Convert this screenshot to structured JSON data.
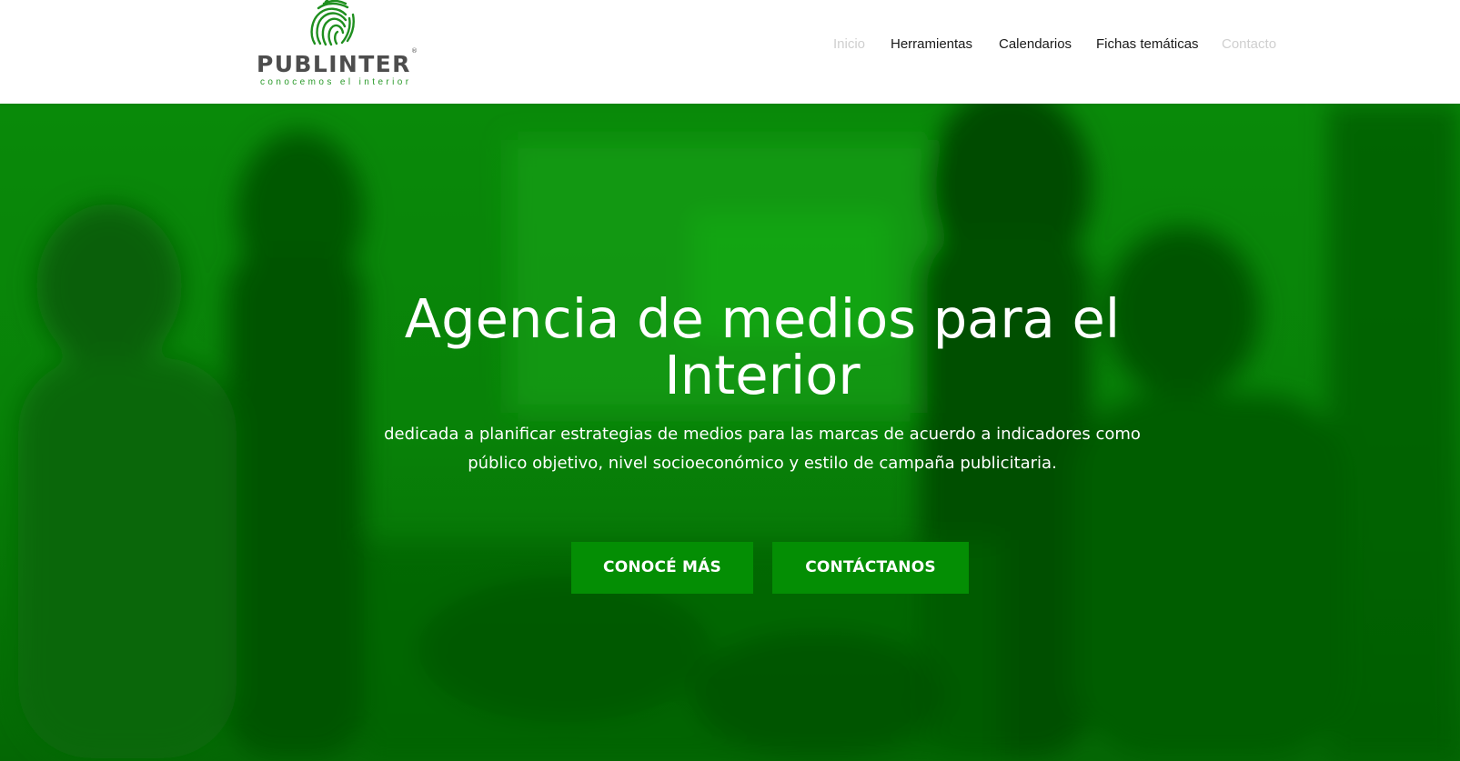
{
  "brand": {
    "name": "PUBLINTER",
    "registered": "®",
    "tagline": "conocemos el interior",
    "color_green": "#2a9a2a",
    "color_gray": "#4d4d4d"
  },
  "nav": {
    "items": [
      {
        "label": "Inicio",
        "state": "muted"
      },
      {
        "label": "Herramientas",
        "state": "normal"
      },
      {
        "label": "Calendarios",
        "state": "normal"
      },
      {
        "label": "Fichas temáticas",
        "state": "normal"
      },
      {
        "label": "Contacto",
        "state": "muted"
      }
    ]
  },
  "hero": {
    "title_line1": "Agencia de medios para el",
    "title_line2": "Interior",
    "subtitle_line1": "dedicada a planificar estrategias de medios para las marcas de acuerdo a indicadores como",
    "subtitle_line2": "público objetivo, nivel socioeconómico y estilo de campaña publicitaria.",
    "overlay_color": "#0b7a0b",
    "buttons": {
      "more_label": "CONOCÉ MÁS",
      "contact_label": "CONTÁCTANOS",
      "color": "#048e04"
    }
  }
}
